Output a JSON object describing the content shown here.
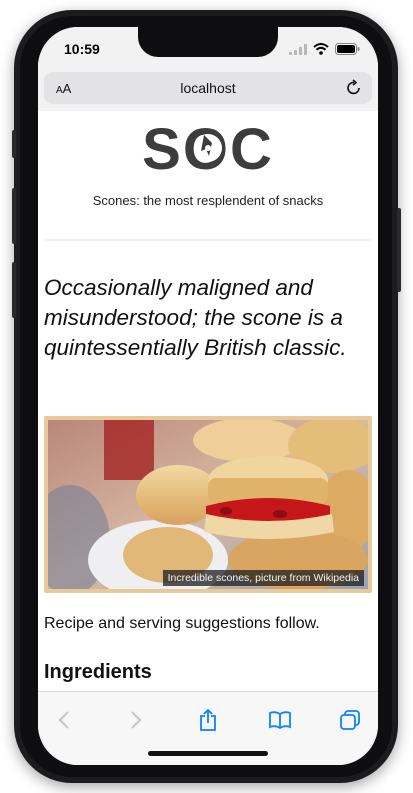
{
  "status_bar": {
    "time": "10:59"
  },
  "browser": {
    "text_size_label": "AA",
    "url": "localhost"
  },
  "page": {
    "logo_text": "SOC",
    "tagline": "Scones: the most resplendent of snacks",
    "lead": "Occasionally maligned and misunderstood; the scone is a quintessentially British classic.",
    "image_caption": "Incredible scones, picture from Wikipedia",
    "recipe_text": "Recipe and serving suggestions follow.",
    "ingredients_heading": "Ingredients"
  },
  "toolbar": {
    "items": [
      "back-icon",
      "forward-icon",
      "share-icon",
      "bookmarks-icon",
      "tabs-icon"
    ]
  },
  "colors": {
    "accent": "#0a84ff",
    "logo": "#3d3d3d",
    "figure_border": "#e7c99a"
  }
}
